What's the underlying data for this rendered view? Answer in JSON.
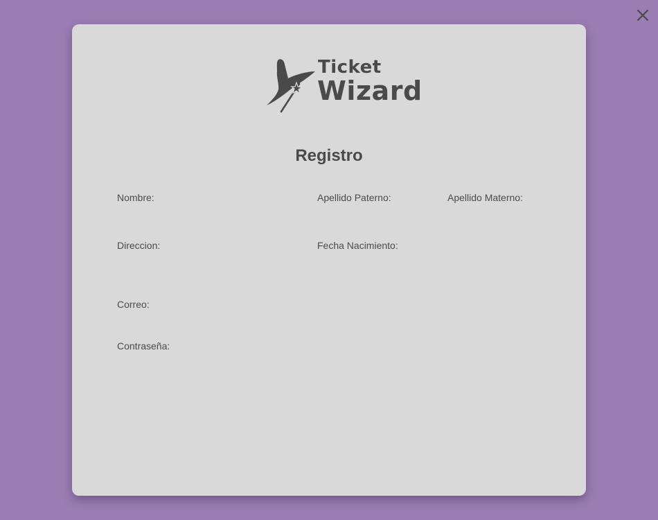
{
  "brand": {
    "line1": "Ticket",
    "line2": "Wizard"
  },
  "form": {
    "title": "Registro",
    "labels": {
      "nombre": "Nombre:",
      "apellido_paterno": "Apellido Paterno:",
      "apellido_materno": "Apellido Materno:",
      "direccion": "Direccion:",
      "fecha_nacimiento": "Fecha Nacimiento:",
      "correo": "Correo:",
      "contrasena": "Contraseña:"
    }
  },
  "colors": {
    "backdrop": "#9b7db3",
    "modal": "#d9d9d9",
    "text": "#4a4a4a"
  },
  "icons": {
    "close": "close-icon",
    "logo": "wizard-hat-icon"
  }
}
